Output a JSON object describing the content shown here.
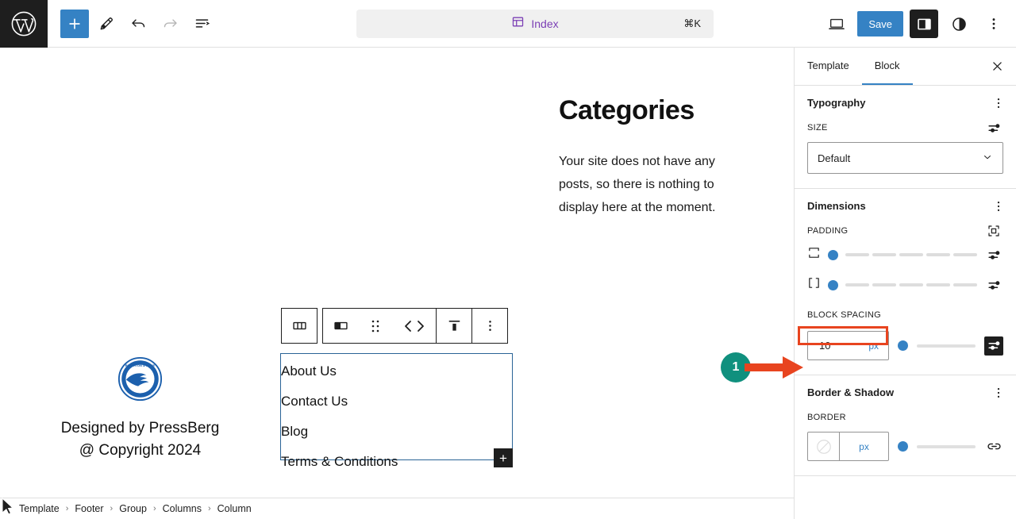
{
  "topbar": {
    "logo_icon": "wordpress-logo-icon",
    "add_label": "+",
    "tools": [
      {
        "name": "block-inserter-button",
        "icon": "plus-icon"
      },
      {
        "name": "edit-tool-button",
        "icon": "pencil-icon"
      },
      {
        "name": "undo-button",
        "icon": "undo-arrow-icon"
      },
      {
        "name": "redo-button",
        "icon": "redo-arrow-icon"
      },
      {
        "name": "document-overview-button",
        "icon": "list-view-icon"
      }
    ],
    "document_title": "Index",
    "document_icon": "template-layout-icon",
    "shortcut": "⌘K",
    "preview_icon": "desktop-preview-icon",
    "save_label": "Save",
    "settings_icon": "sidebar-toggle-icon",
    "styles_icon": "contrast-styles-icon",
    "options_icon": "three-dots-vertical-icon"
  },
  "canvas": {
    "heading": "Categories",
    "body_text": "Your site does not have any posts, so there is nothing to display here at the moment.",
    "logo_icon": "site-logo-seagull-icon",
    "credit_line_1": "Designed by PressBerg",
    "credit_line_2": "@ Copyright 2024",
    "block_toolbar": [
      {
        "name": "block-type-columns-button",
        "icon": "columns-block-icon"
      },
      {
        "name": "block-type-column-button",
        "icon": "column-block-icon"
      },
      {
        "name": "drag-handle",
        "icon": "drag-dots-icon"
      },
      {
        "name": "move-arrows-button",
        "icon": "left-right-arrows-icon"
      },
      {
        "name": "vertical-align-button",
        "icon": "align-top-icon"
      },
      {
        "name": "block-options-button",
        "icon": "three-dots-vertical-icon"
      }
    ],
    "selected_block_links": [
      "About Us",
      "Contact Us",
      "Blog",
      "Terms & Conditions"
    ],
    "add_block_label": "+"
  },
  "breadcrumb": [
    "Template",
    "Footer",
    "Group",
    "Columns",
    "Column"
  ],
  "breadcrumb_separator": "›",
  "sidebar": {
    "tabs": [
      {
        "label": "Template",
        "active": false
      },
      {
        "label": "Block",
        "active": true
      }
    ],
    "close_icon": "close-x-icon",
    "typography": {
      "title": "Typography",
      "options_icon": "three-dots-vertical-icon",
      "size_label": "SIZE",
      "size_tools_icon": "settings-sliders-icon",
      "size_value": "Default",
      "chevron_icon": "chevron-down-icon"
    },
    "dimensions": {
      "title": "Dimensions",
      "options_icon": "three-dots-vertical-icon",
      "padding_label": "PADDING",
      "padding_sides_icon": "padding-sides-icon",
      "vertical_icon": "padding-vertical-icon",
      "horizontal_icon": "padding-horizontal-icon",
      "tools_icon": "settings-sliders-icon",
      "block_spacing_label": "BLOCK SPACING",
      "block_spacing_value": "10",
      "block_spacing_unit": "px",
      "block_spacing_tools_icon": "settings-sliders-icon"
    },
    "border": {
      "title": "Border & Shadow",
      "options_icon": "three-dots-vertical-icon",
      "label": "BORDER",
      "color_swatch_icon": "no-color-swatch-icon",
      "unit": "px",
      "link_icon": "link-sides-icon"
    }
  },
  "annotation": {
    "step_number": "1",
    "circle_color": "#10907e",
    "arrow_color": "#E8441F",
    "highlight_color": "#E8441F"
  }
}
